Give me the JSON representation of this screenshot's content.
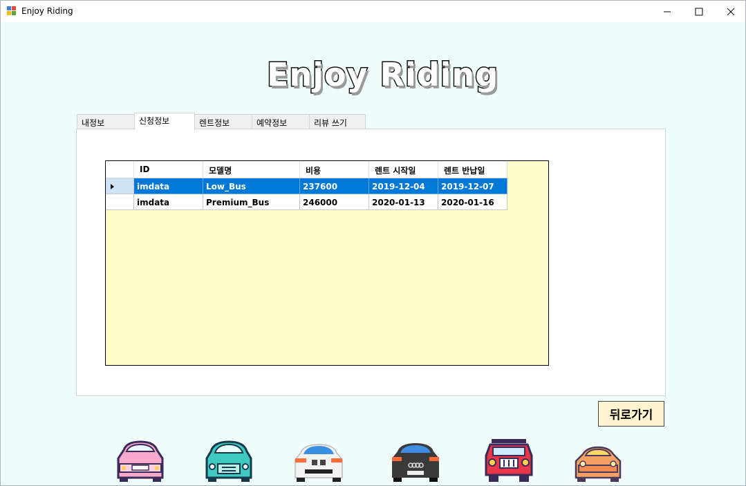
{
  "window": {
    "title": "Enjoy Riding",
    "icon": "app-window-icon",
    "controls": [
      "minimize-icon",
      "maximize-icon",
      "close-icon"
    ]
  },
  "logo": {
    "text": "Enjoy Riding"
  },
  "tabs": [
    {
      "label": "내정보",
      "active": false
    },
    {
      "label": "신청정보",
      "active": true
    },
    {
      "label": "렌트정보",
      "active": false
    },
    {
      "label": "예약정보",
      "active": false
    },
    {
      "label": "리뷰 쓰기",
      "active": false
    }
  ],
  "grid": {
    "columns": [
      "ID",
      "모델명",
      "비용",
      "렌트 시작일",
      "렌트 반납일"
    ],
    "rows": [
      {
        "id": "imdata",
        "model": "Low_Bus",
        "cost": "237600",
        "start": "2019-12-04",
        "end": "2019-12-07",
        "selected": true
      },
      {
        "id": "imdata",
        "model": "Premium_Bus",
        "cost": "246000",
        "start": "2020-01-13",
        "end": "2020-01-16",
        "selected": false
      }
    ],
    "background": "#ffffcc",
    "selection_color": "#0078d7"
  },
  "back_button": {
    "label": "뒤로가기"
  },
  "cars": [
    "car-pink-icon",
    "car-teal-icon",
    "car-white-bmw-icon",
    "car-dark-audi-icon",
    "car-red-jeep-icon",
    "car-orange-icon"
  ]
}
